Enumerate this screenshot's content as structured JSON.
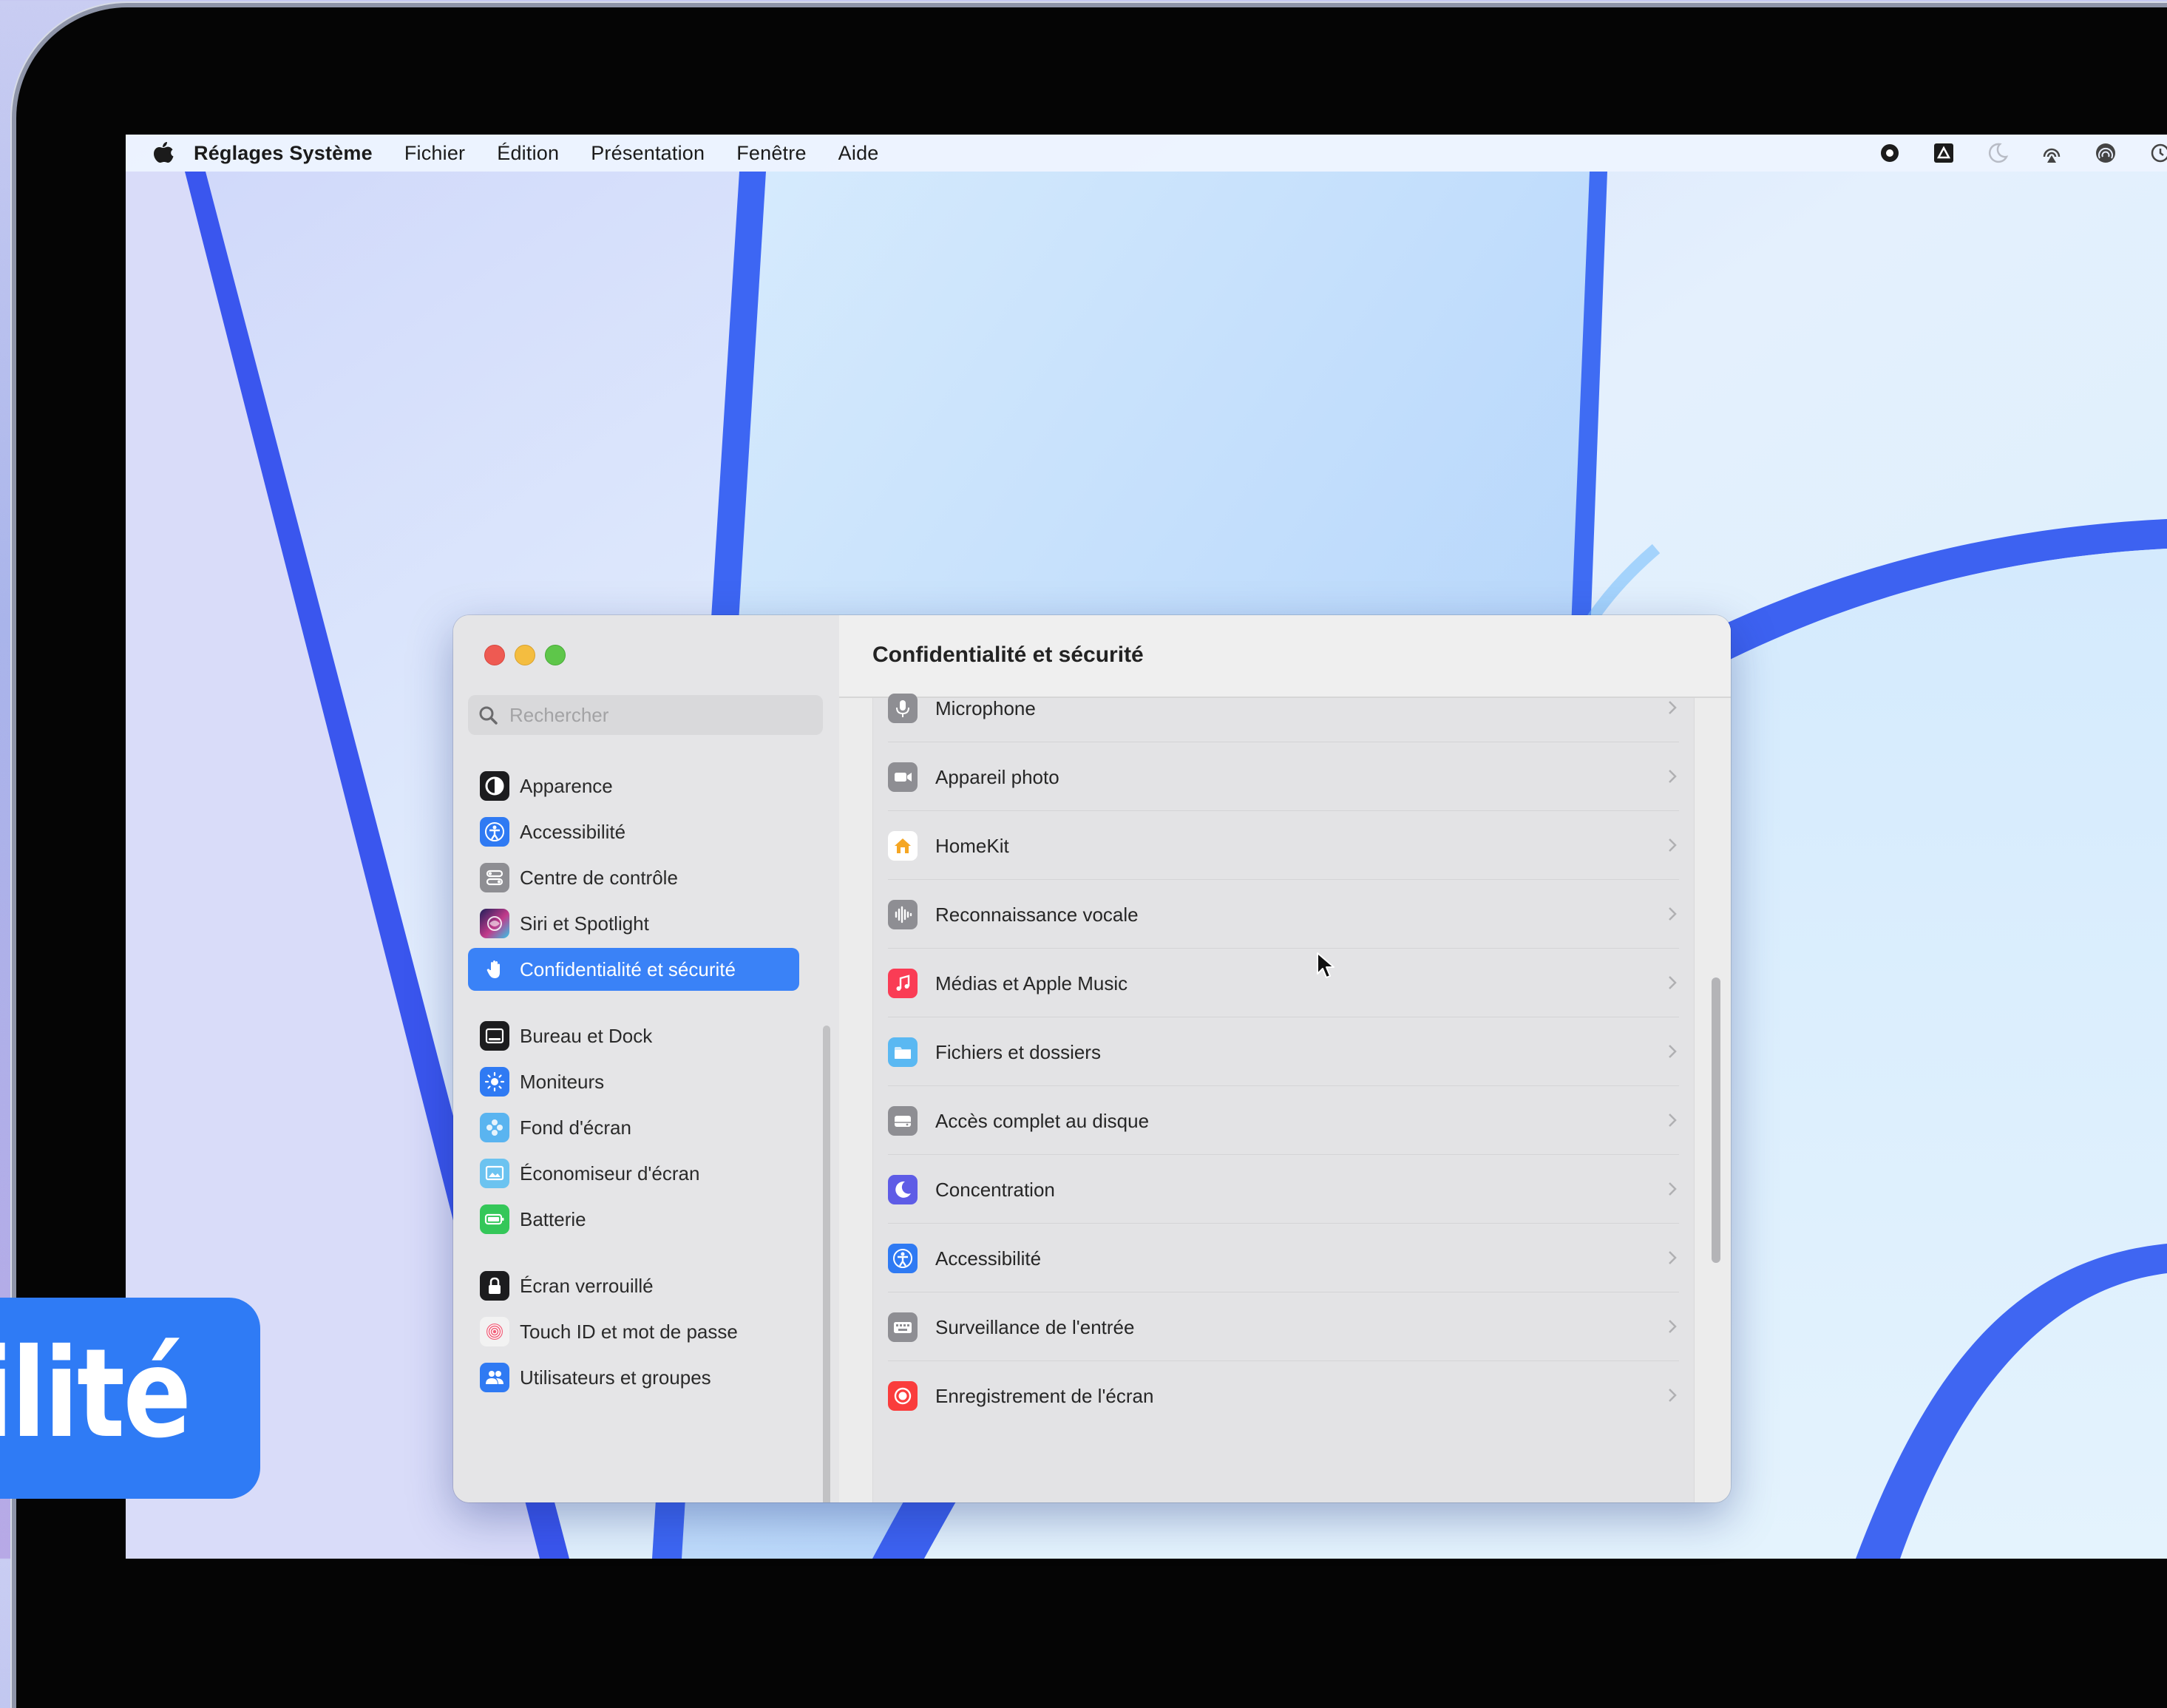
{
  "menubar": {
    "apple_icon": "apple-logo-icon",
    "app_name": "Réglages Système",
    "items": [
      "Fichier",
      "Édition",
      "Présentation",
      "Fenêtre",
      "Aide"
    ],
    "status_icons": [
      "record-icon",
      "drive-icon",
      "focus-moon-icon",
      "airplay-audio-icon",
      "airdrop-icon",
      "time-machine-icon"
    ]
  },
  "window": {
    "title": "Confidentialité et sécurité",
    "search_placeholder": "Rechercher",
    "sidebar": [
      {
        "label": "Apparence",
        "icon": "appearance-icon",
        "color": "#1c1c1e"
      },
      {
        "label": "Accessibilité",
        "icon": "accessibility-icon",
        "color": "#2f7af3"
      },
      {
        "label": "Centre de contrôle",
        "icon": "control-center-icon",
        "color": "#8e8e93"
      },
      {
        "label": "Siri et Spotlight",
        "icon": "siri-icon",
        "color": "#3a3a8c"
      },
      {
        "label": "Confidentialité et sécurité",
        "icon": "hand-icon",
        "color": "#3a82f7",
        "selected": true
      },
      {
        "label": "Bureau et Dock",
        "icon": "dock-icon",
        "color": "#1c1c1e"
      },
      {
        "label": "Moniteurs",
        "icon": "display-icon",
        "color": "#2f7af3"
      },
      {
        "label": "Fond d'écran",
        "icon": "wallpaper-icon",
        "color": "#5ab4f0"
      },
      {
        "label": "Économiseur d'écran",
        "icon": "screensaver-icon",
        "color": "#6cc3f0"
      },
      {
        "label": "Batterie",
        "icon": "battery-icon",
        "color": "#34c759"
      },
      {
        "label": "Écran verrouillé",
        "icon": "lock-icon",
        "color": "#1c1c1e"
      },
      {
        "label": "Touch ID et mot de passe",
        "icon": "fingerprint-icon",
        "color": "#f2f2f2"
      },
      {
        "label": "Utilisateurs et groupes",
        "icon": "users-icon",
        "color": "#2f7af3"
      }
    ],
    "rows": [
      {
        "label": "Microphone",
        "icon": "microphone-icon",
        "color": "#8e8e93"
      },
      {
        "label": "Appareil photo",
        "icon": "camera-icon",
        "color": "#8e8e93"
      },
      {
        "label": "HomeKit",
        "icon": "home-icon",
        "color": "#ffffff"
      },
      {
        "label": "Reconnaissance vocale",
        "icon": "waveform-icon",
        "color": "#8e8e93"
      },
      {
        "label": "Médias et Apple Music",
        "icon": "music-note-icon",
        "color": "#fa3c55"
      },
      {
        "label": "Fichiers et dossiers",
        "icon": "folder-icon",
        "color": "#5ab8f2"
      },
      {
        "label": "Accès complet au disque",
        "icon": "disk-icon",
        "color": "#8e8e93"
      },
      {
        "label": "Concentration",
        "icon": "moon-icon",
        "color": "#5e5ce6"
      },
      {
        "label": "Accessibilité",
        "icon": "accessibility-icon",
        "color": "#2f7af3"
      },
      {
        "label": "Surveillance de l'entrée",
        "icon": "keyboard-icon",
        "color": "#8e8e93"
      },
      {
        "label": "Enregistrement de l'écran",
        "icon": "record-icon",
        "color": "#fa3c3c"
      }
    ]
  },
  "badge": {
    "text": "bilité",
    "color": "#2f7bf5"
  }
}
